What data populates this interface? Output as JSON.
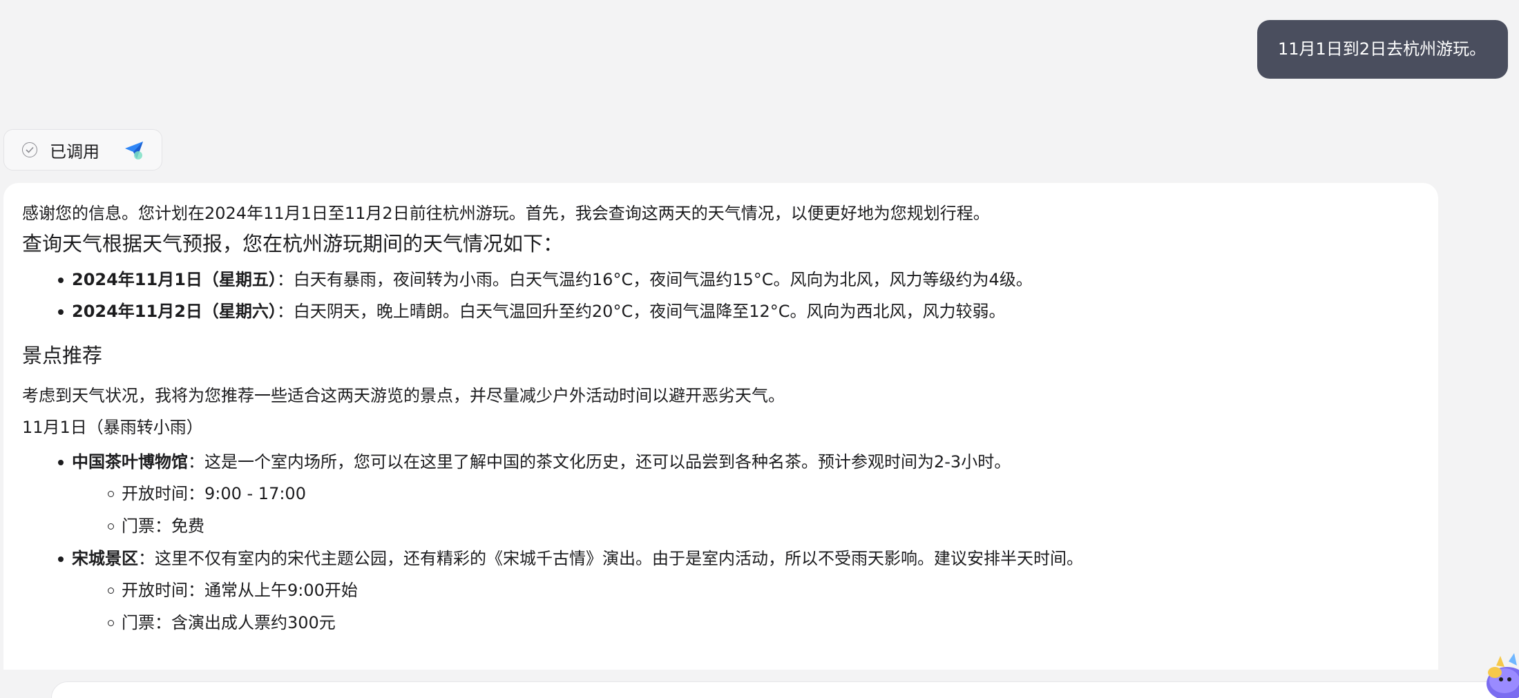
{
  "user_message": "11月1日到2日去杭州游玩。",
  "tool_chip": {
    "label": "已调用",
    "icon": "check-circle-icon",
    "plugin_icon": "weather-plugin-icon"
  },
  "answer": {
    "intro": "感谢您的信息。您计划在2024年11月1日至11月2日前往杭州游玩。首先，我会查询这两天的天气情况，以便更好地为您规划行程。",
    "weather_heading": "查询天气根据天气预报，您在杭州游玩期间的天气情况如下：",
    "weather": [
      {
        "date": "2024年11月1日（星期五）",
        "text": "：白天有暴雨，夜间转为小雨。白天气温约16°C，夜间气温约15°C。风向为北风，风力等级约为4级。"
      },
      {
        "date": "2024年11月2日（星期六）",
        "text": "：白天阴天，晚上晴朗。白天气温回升至约20°C，夜间气温降至12°C。风向为西北风，风力较弱。"
      }
    ],
    "spots_heading": "景点推荐",
    "spots_intro": "考虑到天气状况，我将为您推荐一些适合这两天游览的景点，并尽量减少户外活动时间以避开恶劣天气。",
    "day1_heading": "11月1日（暴雨转小雨）",
    "spots": [
      {
        "name": "中国茶叶博物馆",
        "text": "：这是一个室内场所，您可以在这里了解中国的茶文化历史，还可以品尝到各种名茶。预计参观时间为2-3小时。",
        "details": [
          "开放时间：9:00 - 17:00",
          "门票：免费"
        ]
      },
      {
        "name": "宋城景区",
        "text": "：这里不仅有室内的宋代主题公园，还有精彩的《宋城千古情》演出。由于是室内活动，所以不受雨天影响。建议安排半天时间。",
        "details": [
          "开放时间：通常从上午9:00开始",
          "门票：含演出成人票约300元"
        ]
      }
    ]
  },
  "colors": {
    "bubble": "#4a4e5e",
    "background": "#f3f3f4",
    "card": "#ffffff"
  }
}
